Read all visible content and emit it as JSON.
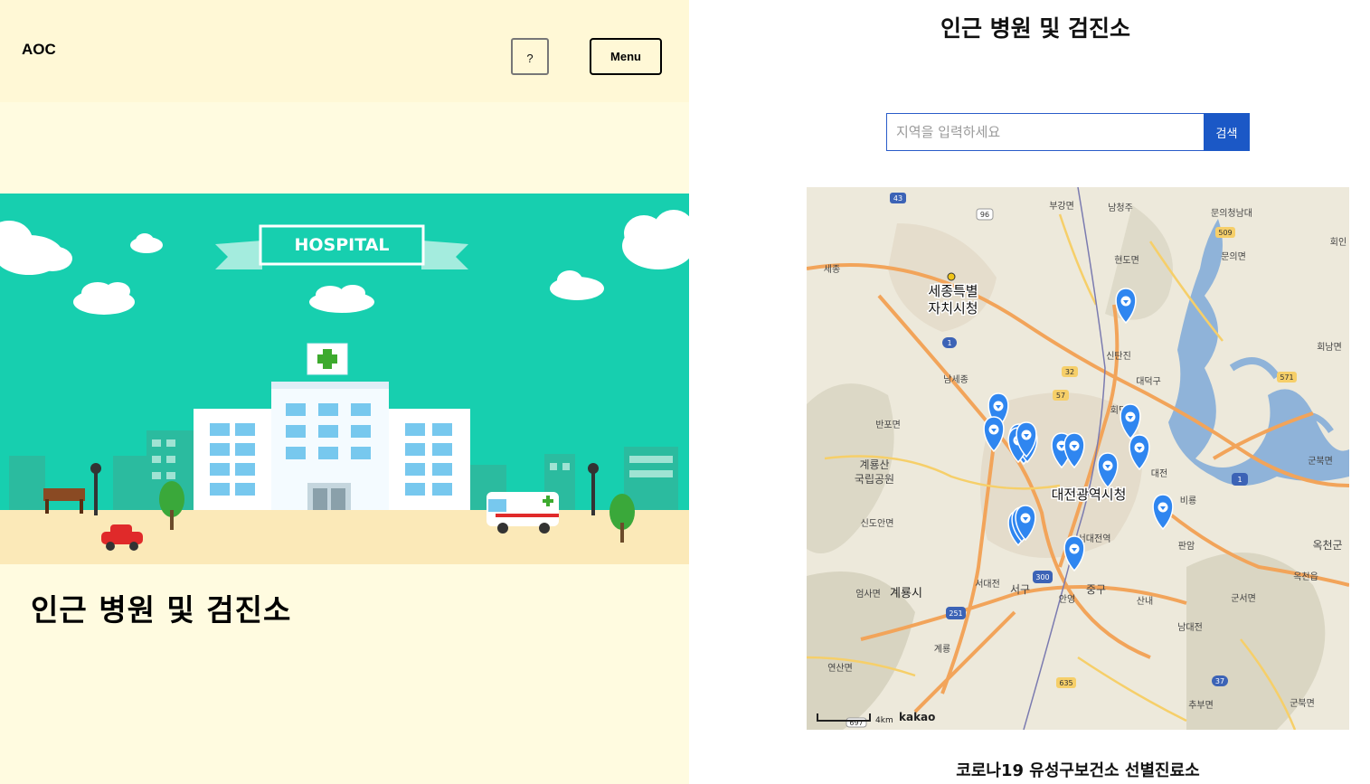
{
  "header": {
    "logo": "AOC",
    "help_label": "?",
    "menu_label": "Menu"
  },
  "hero": {
    "banner_text": "HOSPITAL",
    "title": "인근 병원 및 검진소"
  },
  "right": {
    "title": "인근 병원 및 검진소",
    "search": {
      "placeholder": "지역을 입력하세요",
      "button_label": "검색"
    },
    "result_label": "코로나19 유성구보건소 선별진료소"
  },
  "map": {
    "provider": "kakao",
    "scale_label": "4km",
    "big_labels": [
      "세종특별",
      "자치시청",
      "대전광역시청"
    ],
    "place_labels": [
      "부강면",
      "남청주",
      "문의청남대",
      "세종",
      "현도면",
      "문의면",
      "회인",
      "신탄진",
      "남세종",
      "대덕구",
      "회남면",
      "반포면",
      "회덕",
      "유성",
      "계룡산",
      "국립공원",
      "대전",
      "군북면",
      "비룡",
      "옥천군",
      "신도안면",
      "서대전역",
      "판암",
      "옥천읍",
      "서대전",
      "서구",
      "중구",
      "엄사면",
      "계룡시",
      "안영",
      "산내",
      "군서면",
      "남대전",
      "계룡",
      "연산면",
      "추부면",
      "군북면"
    ],
    "road_numbers": [
      "43",
      "96",
      "509",
      "1",
      "32",
      "57",
      "571",
      "1",
      "300",
      "251",
      "635",
      "37",
      "697"
    ],
    "marker_count": 18
  },
  "colors": {
    "panel_bg": "#fff8d6",
    "accent": "#1b58c6",
    "hero_bg": "#17cfaf",
    "marker": "#2f86f0"
  }
}
